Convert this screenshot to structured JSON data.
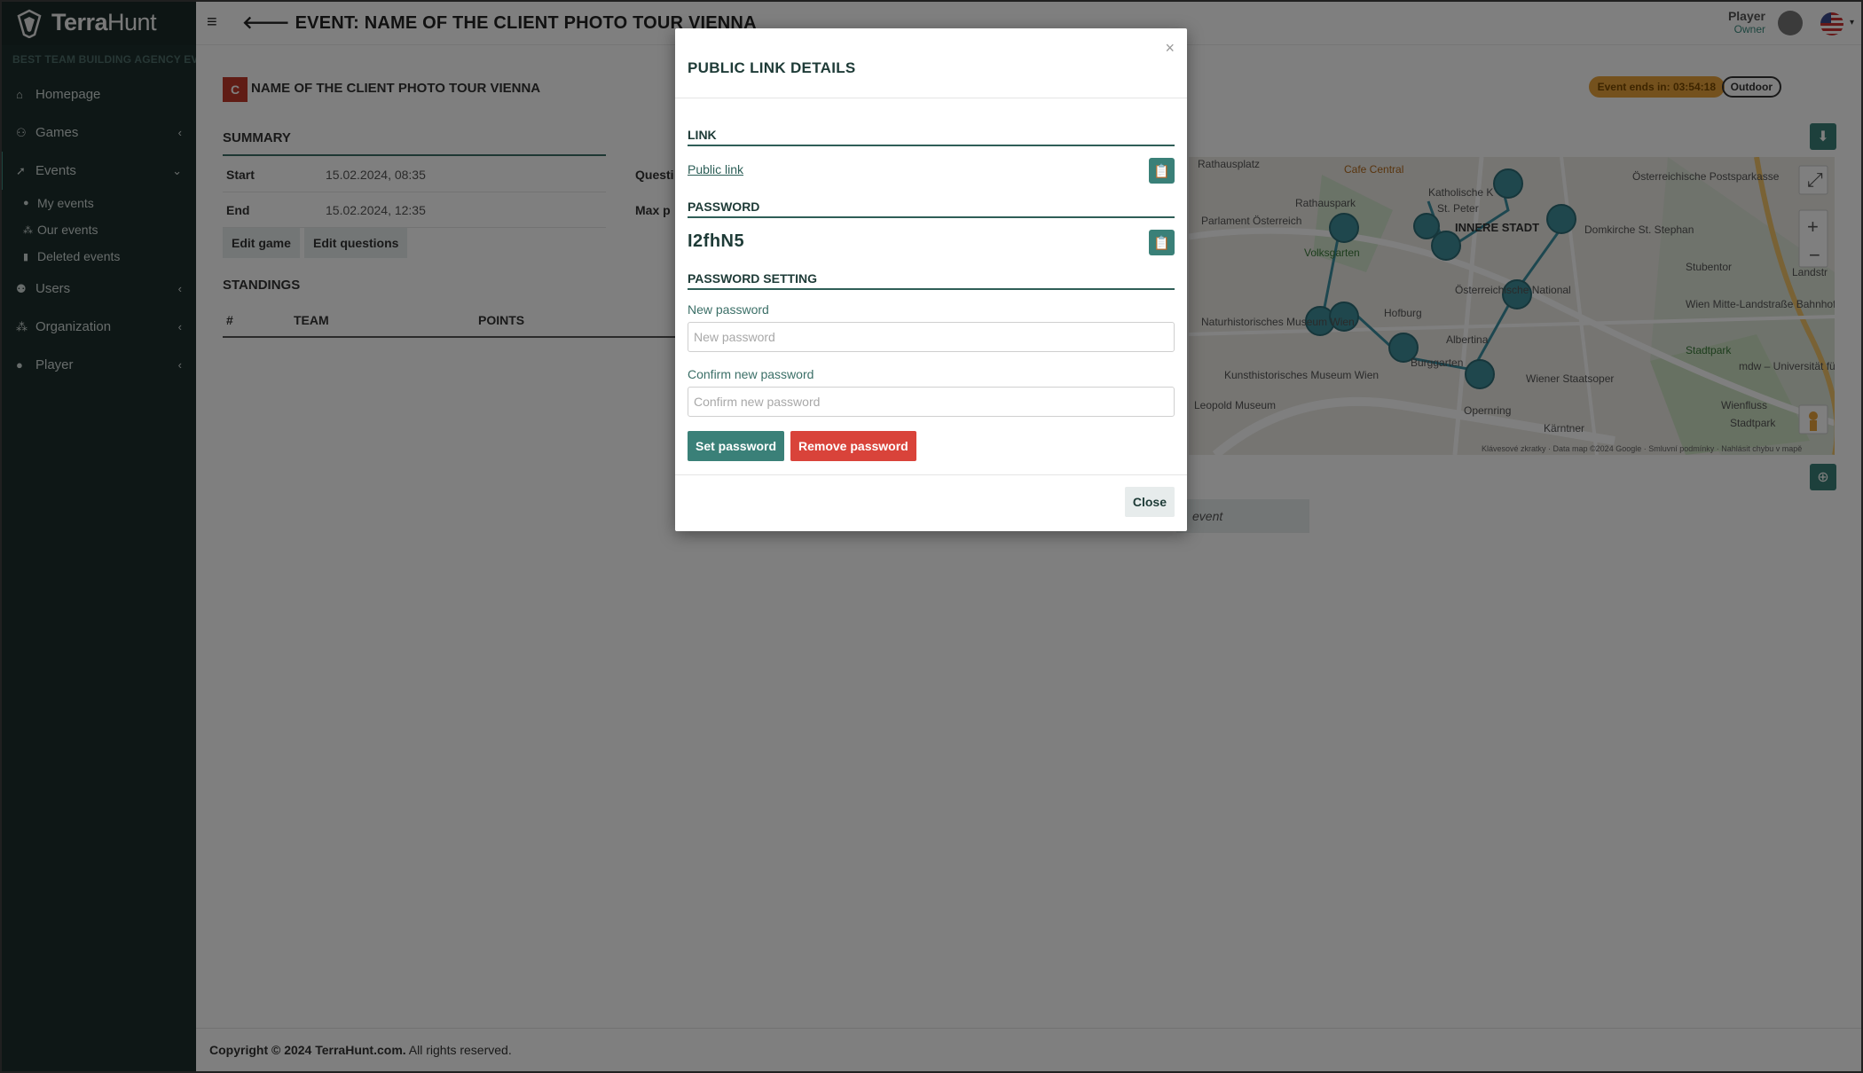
{
  "brand": {
    "name_bold": "Terra",
    "name_light": "Hunt"
  },
  "sidebar": {
    "agency": "BEST TEAM BUILDING AGENCY EVER",
    "items": [
      {
        "label": "Homepage",
        "icon": "home-icon"
      },
      {
        "label": "Games",
        "icon": "gamepad-icon"
      },
      {
        "label": "Events",
        "icon": "rocket-icon"
      },
      {
        "label": "Users",
        "icon": "users-icon"
      },
      {
        "label": "Organization",
        "icon": "sitemap-icon"
      },
      {
        "label": "Player",
        "icon": "user-icon"
      }
    ],
    "event_sub": [
      {
        "label": "My events",
        "icon": "user-icon"
      },
      {
        "label": "Our events",
        "icon": "sitemap-icon"
      },
      {
        "label": "Deleted events",
        "icon": "trash-icon"
      }
    ]
  },
  "header": {
    "title": "EVENT: NAME OF THE CLIENT PHOTO TOUR VIENNA",
    "user_name": "Player",
    "user_role": "Owner"
  },
  "event": {
    "badge": "C",
    "client_name": "NAME OF THE CLIENT PHOTO TOUR VIENNA",
    "ends_in": "Event ends in: 03:54:18",
    "type": "Outdoor"
  },
  "summary": {
    "heading": "SUMMARY",
    "rows": [
      {
        "label": "Start",
        "value": "15.02.2024, 08:35"
      },
      {
        "label": "End",
        "value": "15.02.2024, 12:35"
      }
    ],
    "right_labels": [
      "Questi",
      "Max p"
    ],
    "edit_game": "Edit game",
    "edit_questions": "Edit questions"
  },
  "standings": {
    "heading": "STANDINGS",
    "columns": [
      "#",
      "TEAM",
      "POINTS"
    ]
  },
  "map": {
    "attribution": "Klávesové zkratky · Data map ©2024 Google · Smluvní podmínky · Nahlásit chybu v mapě",
    "labels": [
      "Rathausplatz",
      "Cafe Central",
      "Katholische K",
      "St. Peter",
      "INNERE STADT",
      "Österreichische Postsparkasse",
      "Parlament Österreich",
      "Rathauspark",
      "Volksgarten",
      "Domkirche St. Stephan",
      "Stubentor",
      "Landstr",
      "Österreichische National",
      "Hofburg",
      "Naturhistorisches Museum Wien",
      "Kunsthistorisches Museum Wien",
      "Albertina",
      "Burggarten",
      "Wiener Staatsoper",
      "Wien Mitte-Landstraße Bahnhof",
      "Stadtpark",
      "mdw – Universität für Musik und dars",
      "Leopold Museum",
      "Opernring",
      "Wienfluss",
      "Stadtpark",
      "Kärntner"
    ],
    "extra_button": "event"
  },
  "footer": {
    "copyright": "Copyright © 2024 TerraHunt.com.",
    "rights": " All rights reserved."
  },
  "modal": {
    "title": "PUBLIC LINK DETAILS",
    "close_x": "×",
    "link_heading": "LINK",
    "public_link": "Public link",
    "password_heading": "PASSWORD",
    "password_value": "I2fhN5",
    "setting_heading": "PASSWORD SETTING",
    "new_password_label": "New password",
    "new_password_placeholder": "New password",
    "confirm_password_label": "Confirm new password",
    "confirm_password_placeholder": "Confirm new password",
    "set_button": "Set password",
    "remove_button": "Remove password",
    "close_button": "Close"
  },
  "colors": {
    "sidebar_bg": "#1d2e2c",
    "accent": "#3a8078",
    "danger": "#d9433a",
    "warning": "#e8a23a",
    "heading_dark": "#1e3b37"
  }
}
